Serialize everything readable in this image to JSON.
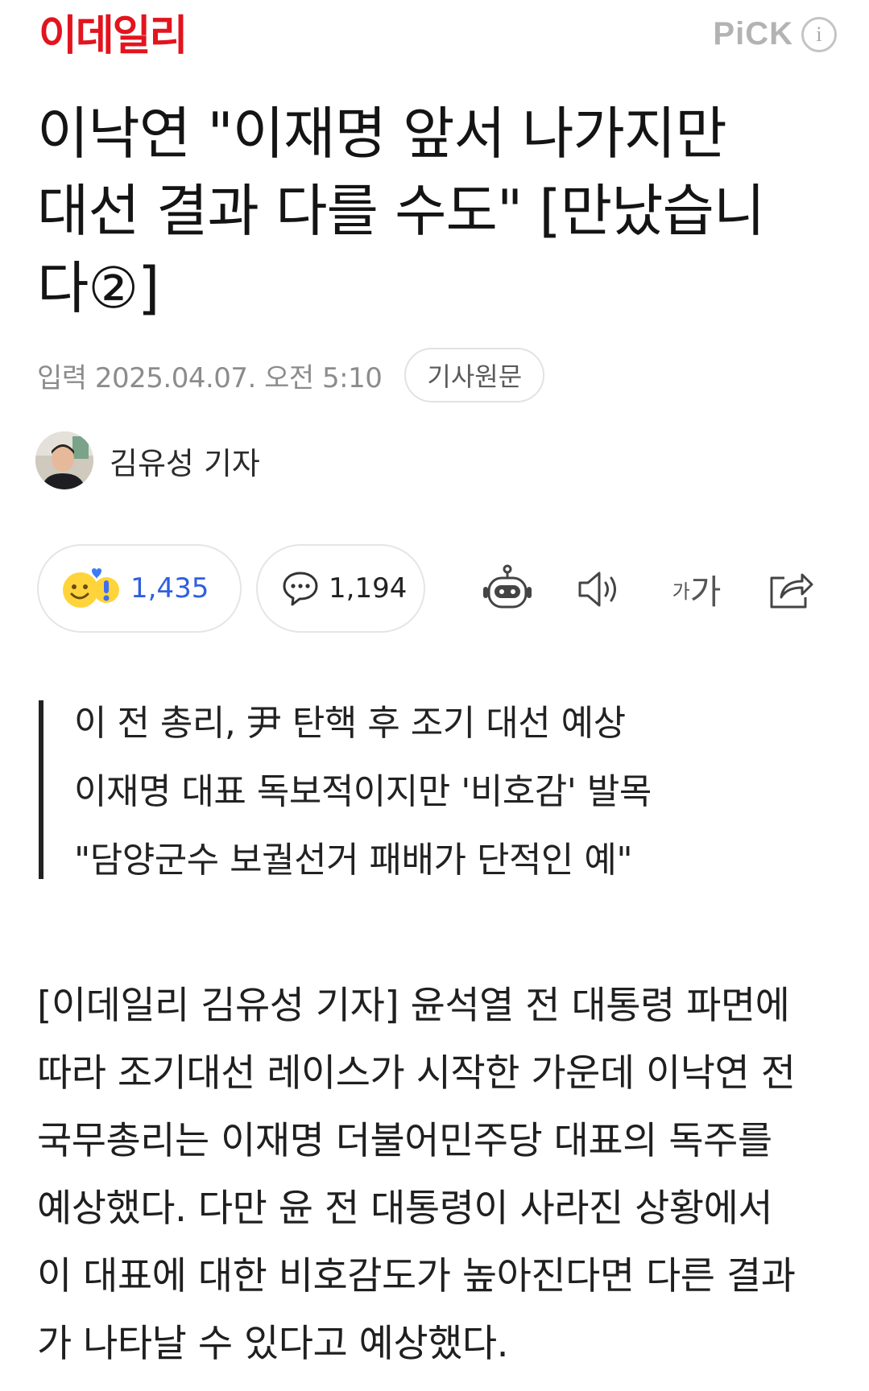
{
  "header": {
    "brand": "이데일리",
    "pick_label": "PiCK",
    "info_icon": "info-icon"
  },
  "article": {
    "title_lines": [
      "이낙연 \"이재명 앞서 나가지만",
      "대선 결과 다를 수도\" [만났습니",
      "다②]"
    ],
    "published": "입력 2025.04.07. 오전 5:10",
    "original_button": "기사원문",
    "author": "김유성 기자"
  },
  "actions": {
    "reaction_count": "1,435",
    "comment_count": "1,194",
    "tools": [
      "robot-summary-icon",
      "speaker-icon",
      "font-size-icon",
      "share-icon"
    ],
    "font_size_label_small": "가",
    "font_size_label_large": "가"
  },
  "summary": {
    "lines": [
      "이 전 총리, 尹 탄핵 후 조기 대선 예상",
      "이재명 대표 독보적이지만 '비호감' 발목",
      "\"담양군수 보궐선거 패배가 단적인 예\""
    ]
  },
  "body": {
    "lines": [
      "[이데일리 김유성 기자] 윤석열 전 대통령 파면에",
      "따라 조기대선 레이스가 시작한 가운데 이낙연 전",
      "국무총리는 이재명 더불어민주당 대표의 독주를",
      "예상했다. 다만 윤 전 대통령이 사라진 상황에서",
      "이 대표에 대한 비호감도가 높아진다면 다른 결과",
      "가 나타날 수 있다고 예상했다."
    ]
  },
  "colors": {
    "brand": "#e2141e",
    "reaction_count": "#2f5fe0",
    "muted": "#8c8c8c"
  }
}
